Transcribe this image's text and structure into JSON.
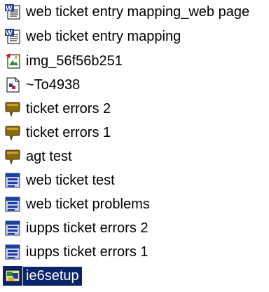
{
  "window": {
    "width": 384,
    "height": 416
  },
  "colors": {
    "selection": "#0a246a",
    "selection_text": "#ffffff",
    "text": "#000000"
  },
  "files": [
    {
      "name": "web ticket entry mapping_web page",
      "icon": "word-document-icon"
    },
    {
      "name": "web ticket entry mapping",
      "icon": "word-document-icon"
    },
    {
      "name": "img_56f56b251",
      "icon": "image-file-icon"
    },
    {
      "name": "~To4938",
      "icon": "temp-file-icon"
    },
    {
      "name": "ticket errors 2",
      "icon": "chm-help-icon"
    },
    {
      "name": "ticket errors 1",
      "icon": "chm-help-icon"
    },
    {
      "name": "agt test",
      "icon": "chm-help-icon"
    },
    {
      "name": "web ticket test",
      "icon": "zip-archive-icon"
    },
    {
      "name": "web ticket problems",
      "icon": "zip-archive-icon"
    },
    {
      "name": "iupps ticket errors 2",
      "icon": "zip-archive-icon"
    },
    {
      "name": "iupps ticket errors 1",
      "icon": "zip-archive-icon"
    },
    {
      "name": "ie6setup",
      "icon": "setup-program-icon",
      "selected": true
    }
  ]
}
